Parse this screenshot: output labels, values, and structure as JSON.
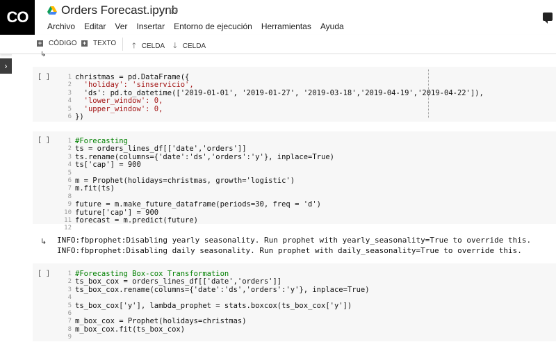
{
  "app": {
    "logo_text": "CO",
    "notebook_title": "Orders Forecast.ipynb",
    "star_glyph": "☆"
  },
  "menu": [
    "Archivo",
    "Editar",
    "Ver",
    "Insertar",
    "Entorno de ejecución",
    "Herramientas",
    "Ayuda"
  ],
  "toolbar": {
    "add_code": "CÓDIGO",
    "add_text": "TEXTO",
    "cell_up": "CELDA",
    "cell_down": "CELDA"
  },
  "cells": [
    {
      "prompt": "[ ]",
      "line_numbers": "1\n2\n3\n4\n5\n6",
      "lines": [
        "christmas = pd.DataFrame({",
        "  'holiday': 'sinservicio',",
        "  'ds': pd.to_datetime(['2019-01-01', '2019-01-27', '2019-03-18','2019-04-19','2019-04-22']),",
        "  'lower_window': 0,",
        "  'upper_window': 0,",
        "})"
      ]
    },
    {
      "prompt": "[ ]",
      "line_numbers": "1\n2\n3\n4\n5\n6\n7\n8\n9\n10\n11\n12",
      "lines": [
        "#Forecasting",
        "ts = orders_lines_df[['date','orders']]",
        "ts.rename(columns={'date':'ds','orders':'y'}, inplace=True)",
        "ts['cap'] = 900",
        "",
        "m = Prophet(holidays=christmas, growth='logistic')",
        "m.fit(ts)",
        "",
        "future = m.make_future_dataframe(periods=30, freq = 'd')",
        "future['cap'] = 900",
        "forecast = m.predict(future)",
        ""
      ]
    },
    {
      "prompt": "[ ]",
      "line_numbers": "1\n2\n3\n4\n5\n6\n7\n8\n9",
      "lines": [
        "#Forecasting Box-cox Transformation",
        "ts_box_cox = orders_lines_df[['date','orders']]",
        "ts_box_cox.rename(columns={'date':'ds','orders':'y'}, inplace=True)",
        "",
        "ts_box_cox['y'], lambda_prophet = stats.boxcox(ts_box_cox['y'])",
        "",
        "m_box_cox = Prophet(holidays=christmas)",
        "m_box_cox.fit(ts_box_cox)",
        ""
      ]
    }
  ],
  "output": {
    "text": "INFO:fbprophet:Disabling yearly seasonality. Run prophet with yearly_seasonality=True to override this.\nINFO:fbprophet:Disabling daily seasonality. Run prophet with daily_seasonality=True to override this."
  }
}
